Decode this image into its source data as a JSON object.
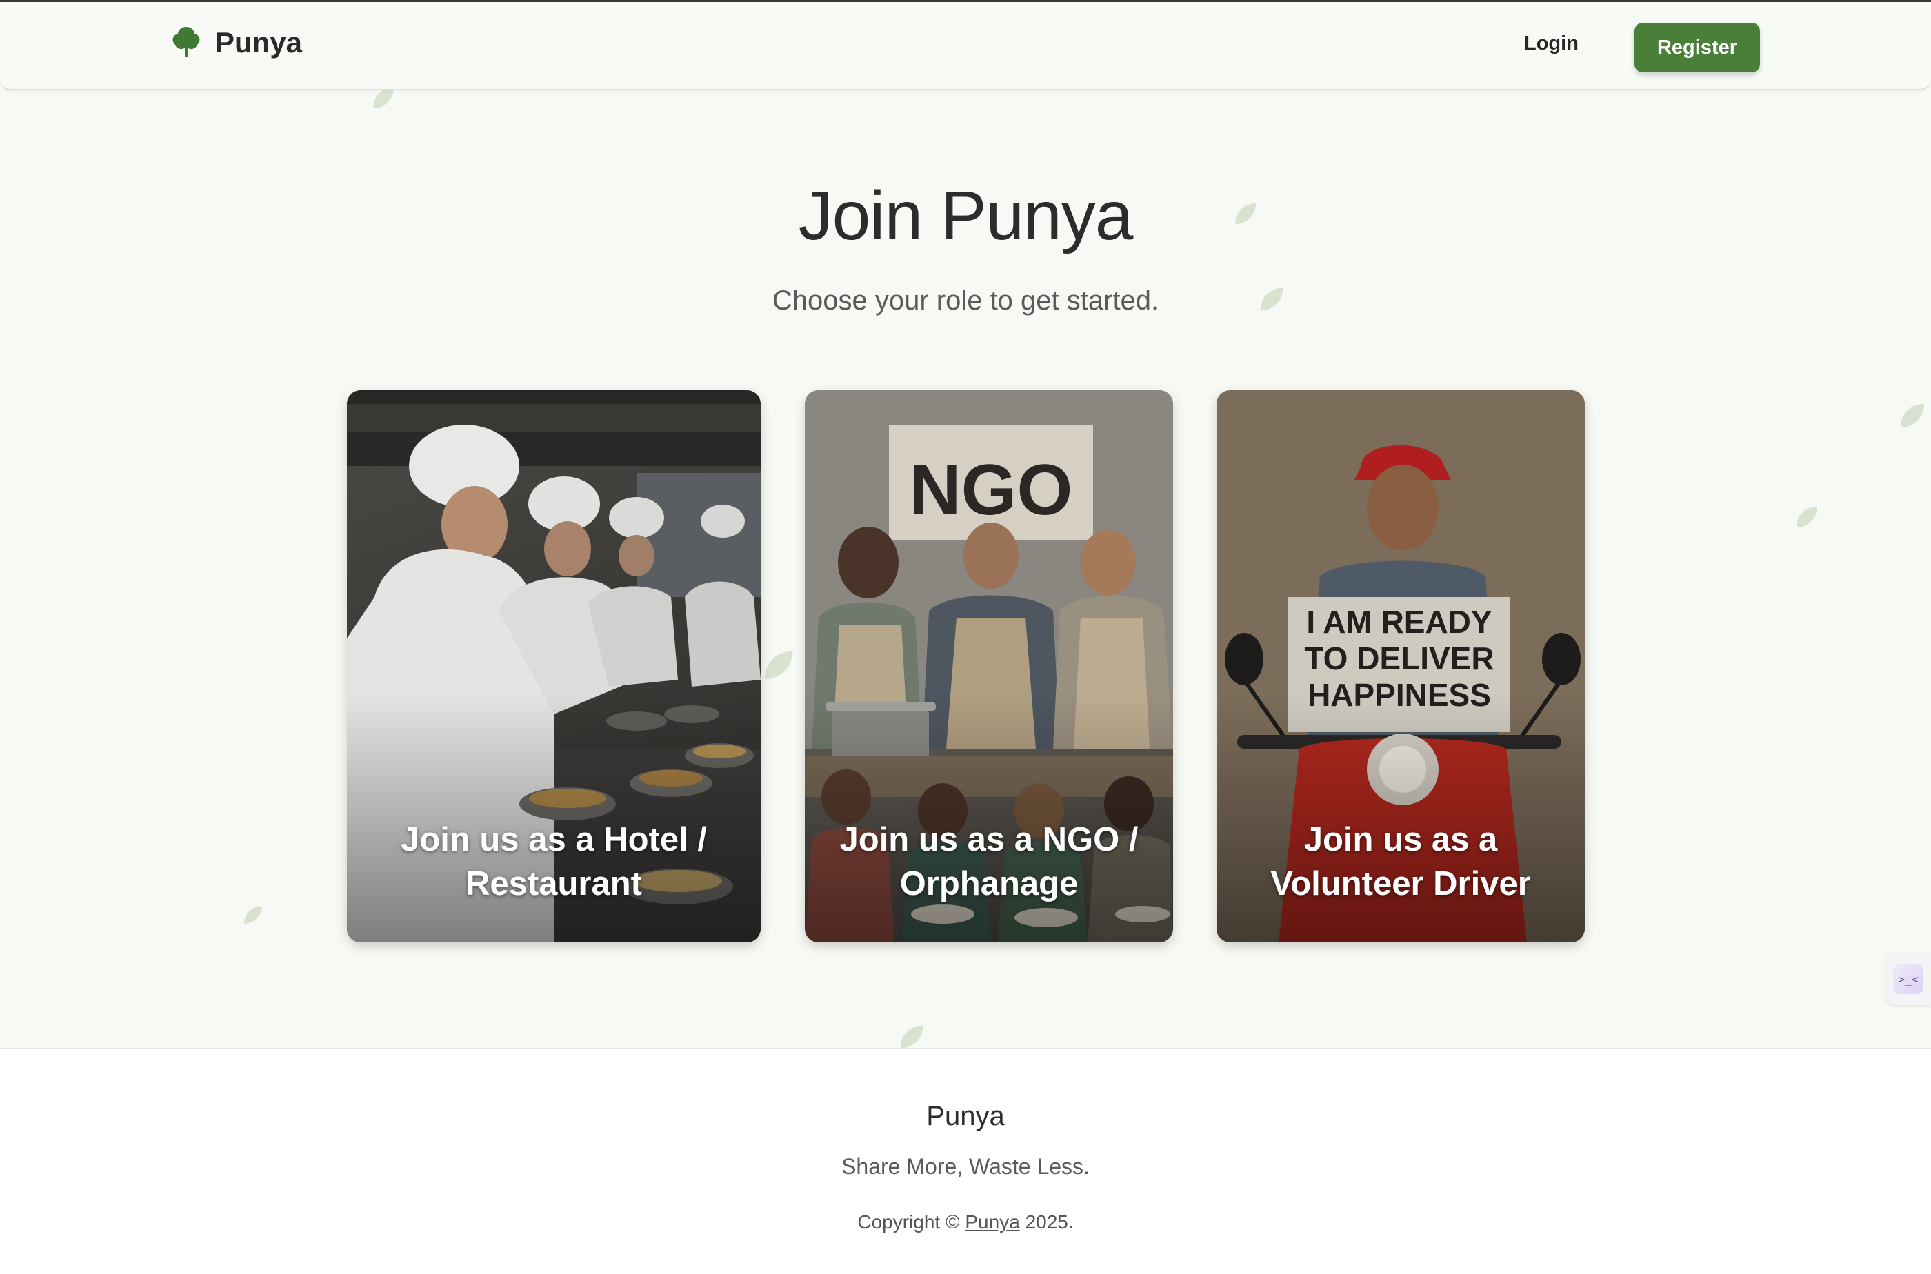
{
  "header": {
    "brand_name": "Punya",
    "login_label": "Login",
    "register_label": "Register"
  },
  "hero": {
    "title": "Join Punya",
    "subtitle": "Choose your role to get started."
  },
  "cards": [
    {
      "label": "Join us as a Hotel / Restaurant",
      "image": "chefs-plating-food-photo"
    },
    {
      "label": "Join us as a NGO / Orphanage",
      "image": "ngo-volunteers-serving-children-photo",
      "sign_text": "NGO"
    },
    {
      "label": "Join us as a Volunteer Driver",
      "image": "scooter-driver-holding-sign-photo",
      "sign_text": [
        "I AM READY",
        "TO DELIVER",
        "HAPPINESS"
      ]
    }
  ],
  "footer": {
    "brand": "Punya",
    "tagline": "Share More, Waste Less.",
    "copyright_prefix": "Copyright ©",
    "copyright_link": "Punya",
    "copyright_year": "2025."
  },
  "side_widget": {
    "icon": "chat-assistant-icon",
    "glyph": ">_<"
  },
  "colors": {
    "accent": "#4a7f3a",
    "background": "#f7f9f4",
    "footer_bg": "#ffffff"
  }
}
